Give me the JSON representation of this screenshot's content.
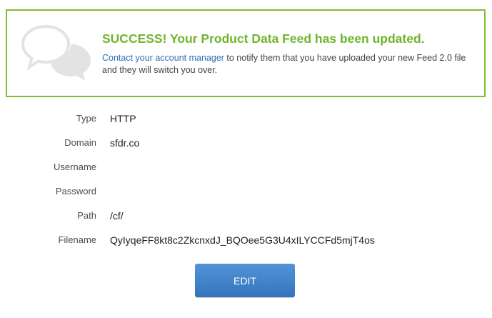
{
  "alert": {
    "icon": "speech-bubbles-icon",
    "title": "SUCCESS! Your Product Data Feed has been updated.",
    "link_text": "Contact your account manager",
    "body_text": " to notify them that you have uploaded your new Feed 2.0 file and they will switch you over.",
    "border_color": "#82bd2c",
    "title_color": "#6fb52c",
    "link_color": "#2f6fb4"
  },
  "details": {
    "type": {
      "label": "Type",
      "value": "HTTP"
    },
    "domain": {
      "label": "Domain",
      "value": "sfdr.co"
    },
    "username": {
      "label": "Username",
      "value": ""
    },
    "password": {
      "label": "Password",
      "value": ""
    },
    "path": {
      "label": "Path",
      "value": "/cf/"
    },
    "filename": {
      "label": "Filename",
      "value": "QyIyqeFF8kt8c2ZkcnxdJ_BQOee5G3U4xILYCCFd5mjT4os"
    }
  },
  "actions": {
    "edit_label": "EDIT",
    "edit_color": "#3f82c8"
  }
}
